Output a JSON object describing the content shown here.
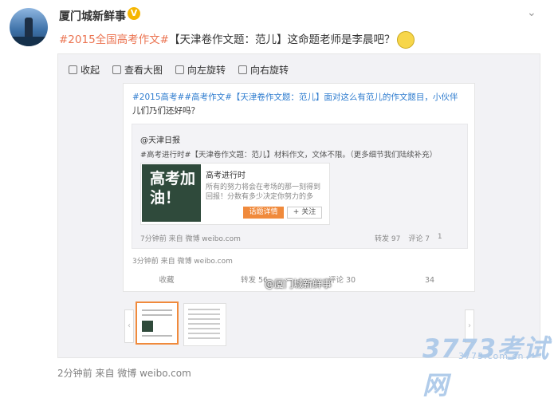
{
  "post": {
    "author": "厦门城新鲜事",
    "verified_badge": "V",
    "text_part1": "#2015全国高考作文#",
    "text_part2": "【天津卷作文题：范儿】这命题老师是李晨吧？",
    "time_source": "2分钟前 来自 微博 weibo.com"
  },
  "media_toolbar": {
    "collapse": "收起",
    "view_large": "查看大图",
    "rotate_left": "向左旋转",
    "rotate_right": "向右旋转"
  },
  "screenshot": {
    "line1": "#2015高考##高考作文#【天津卷作文题：范儿】面对这么有范儿的作文题目，小伙伴",
    "line2": "儿们乃们还好吗？",
    "inner_author": "@天津日报",
    "inner_text": "#高考进行时#【天津卷作文题：范儿】材料作文，文体不限。（更多细节我们陆续补充）",
    "card_image_text": "高考加油！",
    "card_title": "高考进行时",
    "card_desc": "所有的努力将会在考场的那一刻得到回报！分数有多少决定你努力的多",
    "card_btn_topic": "话题详情",
    "card_btn_follow": "+ 关注",
    "inner_meta": "7分钟前 来自 微博 weibo.com",
    "inner_repost": "转发 97",
    "inner_comment": "评论 7",
    "inner_like": "1",
    "outer_meta": "3分钟前 来自 微博 weibo.com",
    "action_collect": "收藏",
    "action_repost": "转发 56",
    "action_comment": "评论 30",
    "action_like": "34",
    "watermark": "@厦门城新鲜事"
  },
  "site_watermark": {
    "logo": "3773考试网",
    "url": "3773.com.cn"
  },
  "icons": {
    "dropdown": "chevron-down-icon",
    "collapse": "collapse-icon",
    "view_large": "magnifier-icon",
    "rotate_left": "rotate-left-icon",
    "rotate_right": "rotate-right-icon"
  },
  "colors": {
    "topic_link": "#eb7350",
    "orange_button": "#f08a3c",
    "verified": "#f6b600"
  }
}
